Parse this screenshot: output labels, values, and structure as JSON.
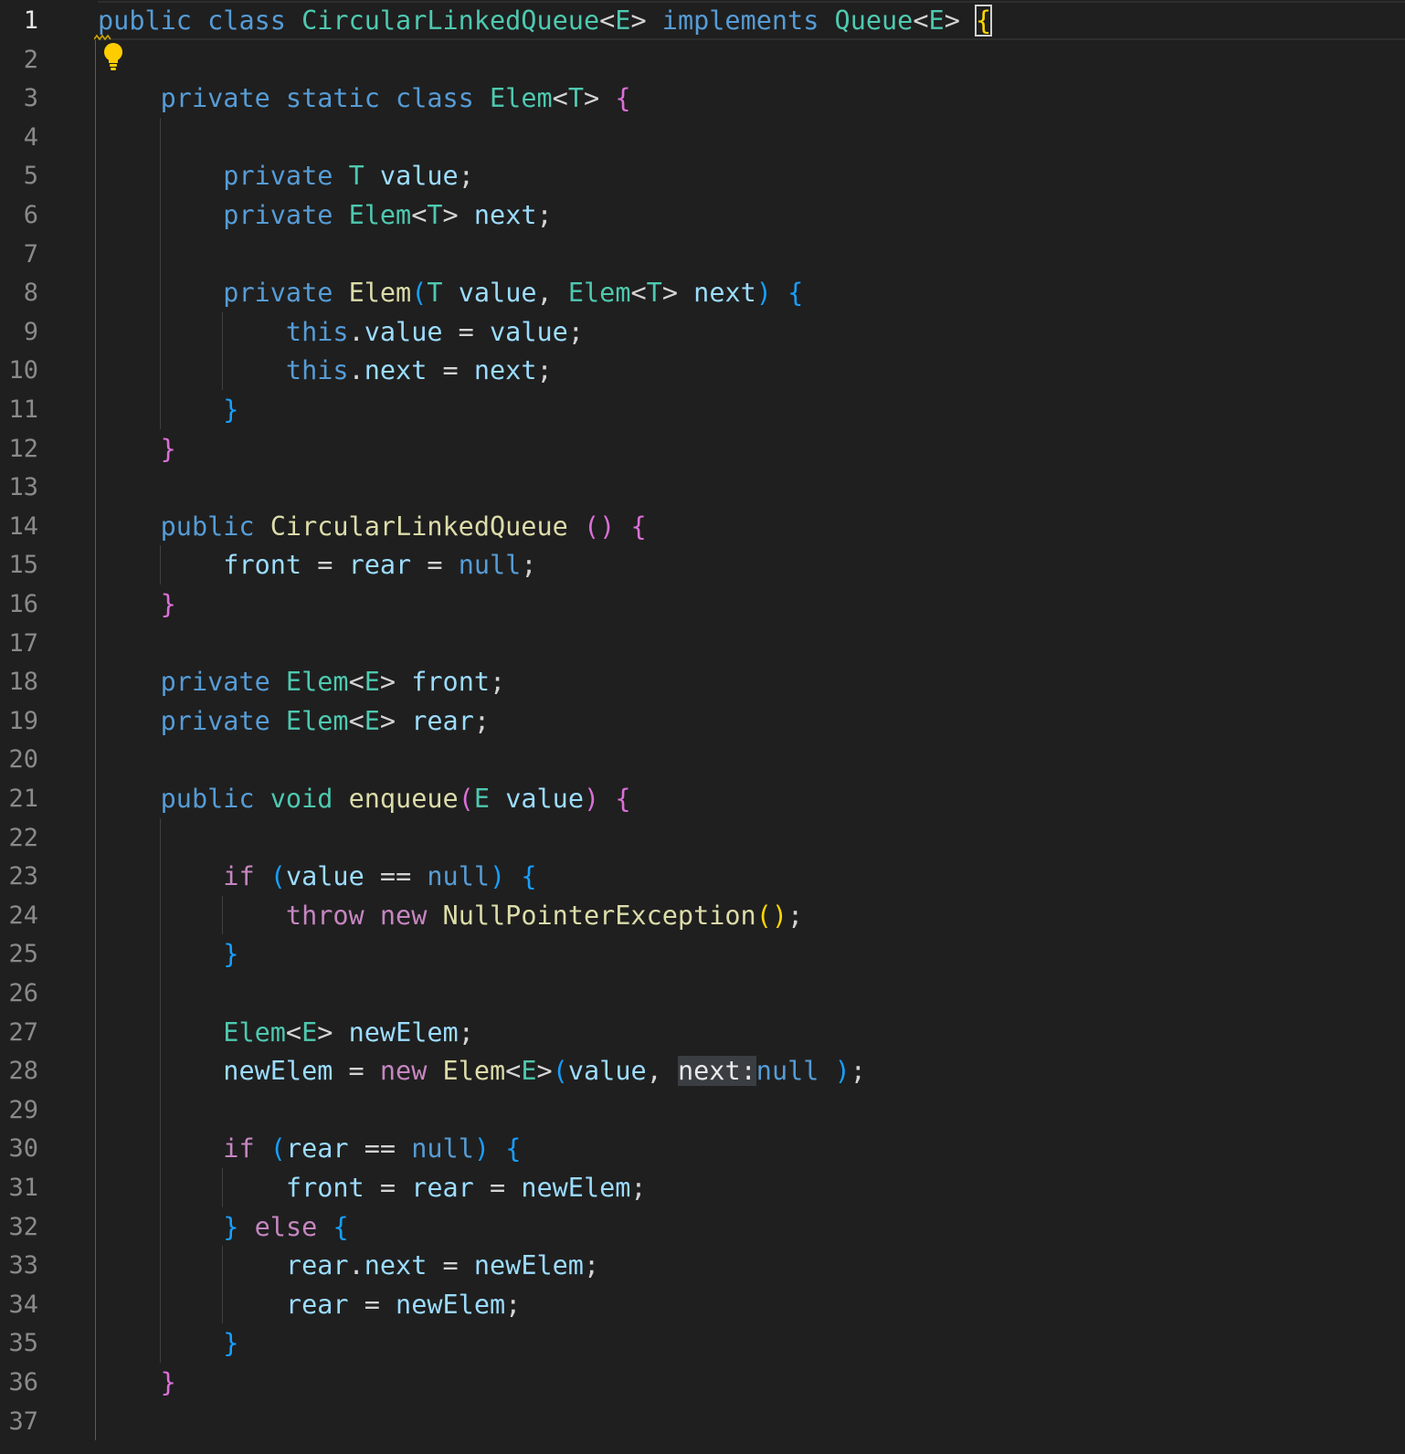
{
  "editor": {
    "language": "java",
    "current_line": 1,
    "line_numbers": [
      "1",
      "2",
      "3",
      "4",
      "5",
      "6",
      "7",
      "8",
      "9",
      "10",
      "11",
      "12",
      "13",
      "14",
      "15",
      "16",
      "17",
      "18",
      "19",
      "20",
      "21",
      "22",
      "23",
      "24",
      "25",
      "26",
      "27",
      "28",
      "29",
      "30",
      "31",
      "32",
      "33",
      "34",
      "35",
      "36",
      "37"
    ],
    "colors": {
      "background": "#1f1f1f",
      "keyword": "#569cd6",
      "control_keyword": "#c586c0",
      "type": "#4ec9b0",
      "function": "#dcdcaa",
      "variable": "#9cdcfe",
      "bracket_level_1": "#ffd700",
      "bracket_level_2": "#da70d6",
      "bracket_level_3": "#179fff",
      "inlay_hint_bg": "#3a3d41"
    },
    "lightbulb_icon": "lightbulb-icon",
    "lines": [
      [
        [
          "kw-blue",
          "public"
        ],
        [
          "punc",
          " "
        ],
        [
          "kw-blue",
          "class"
        ],
        [
          "punc",
          " "
        ],
        [
          "type",
          "CircularLinkedQueue"
        ],
        [
          "punc",
          "<"
        ],
        [
          "type",
          "E"
        ],
        [
          "punc",
          "> "
        ],
        [
          "kw-blue",
          "implements"
        ],
        [
          "punc",
          " "
        ],
        [
          "type",
          "Queue"
        ],
        [
          "punc",
          "<"
        ],
        [
          "type",
          "E"
        ],
        [
          "punc",
          "> "
        ],
        [
          "b1 cursor-box",
          "{"
        ]
      ],
      [],
      [
        [
          "punc",
          "    "
        ],
        [
          "kw-blue",
          "private"
        ],
        [
          "punc",
          " "
        ],
        [
          "kw-blue",
          "static"
        ],
        [
          "punc",
          " "
        ],
        [
          "kw-blue",
          "class"
        ],
        [
          "punc",
          " "
        ],
        [
          "type",
          "Elem"
        ],
        [
          "punc",
          "<"
        ],
        [
          "type",
          "T"
        ],
        [
          "punc",
          "> "
        ],
        [
          "b2",
          "{"
        ]
      ],
      [],
      [
        [
          "punc",
          "        "
        ],
        [
          "kw-blue",
          "private"
        ],
        [
          "punc",
          " "
        ],
        [
          "type",
          "T"
        ],
        [
          "punc",
          " "
        ],
        [
          "var",
          "value"
        ],
        [
          "punc",
          ";"
        ]
      ],
      [
        [
          "punc",
          "        "
        ],
        [
          "kw-blue",
          "private"
        ],
        [
          "punc",
          " "
        ],
        [
          "type",
          "Elem"
        ],
        [
          "punc",
          "<"
        ],
        [
          "type",
          "T"
        ],
        [
          "punc",
          "> "
        ],
        [
          "var",
          "next"
        ],
        [
          "punc",
          ";"
        ]
      ],
      [],
      [
        [
          "punc",
          "        "
        ],
        [
          "kw-blue",
          "private"
        ],
        [
          "punc",
          " "
        ],
        [
          "fn",
          "Elem"
        ],
        [
          "b3",
          "("
        ],
        [
          "type",
          "T"
        ],
        [
          "punc",
          " "
        ],
        [
          "var",
          "value"
        ],
        [
          "punc",
          ", "
        ],
        [
          "type",
          "Elem"
        ],
        [
          "punc",
          "<"
        ],
        [
          "type",
          "T"
        ],
        [
          "punc",
          "> "
        ],
        [
          "var",
          "next"
        ],
        [
          "b3",
          ")"
        ],
        [
          "punc",
          " "
        ],
        [
          "b3",
          "{"
        ]
      ],
      [
        [
          "punc",
          "            "
        ],
        [
          "kw-blue",
          "this"
        ],
        [
          "punc",
          "."
        ],
        [
          "var",
          "value"
        ],
        [
          "punc",
          " = "
        ],
        [
          "var",
          "value"
        ],
        [
          "punc",
          ";"
        ]
      ],
      [
        [
          "punc",
          "            "
        ],
        [
          "kw-blue",
          "this"
        ],
        [
          "punc",
          "."
        ],
        [
          "var",
          "next"
        ],
        [
          "punc",
          " = "
        ],
        [
          "var",
          "next"
        ],
        [
          "punc",
          ";"
        ]
      ],
      [
        [
          "punc",
          "        "
        ],
        [
          "b3",
          "}"
        ]
      ],
      [
        [
          "punc",
          "    "
        ],
        [
          "b2",
          "}"
        ]
      ],
      [],
      [
        [
          "punc",
          "    "
        ],
        [
          "kw-blue",
          "public"
        ],
        [
          "punc",
          " "
        ],
        [
          "fn",
          "CircularLinkedQueue"
        ],
        [
          "punc",
          " "
        ],
        [
          "b2",
          "()"
        ],
        [
          "punc",
          " "
        ],
        [
          "b2",
          "{"
        ]
      ],
      [
        [
          "punc",
          "        "
        ],
        [
          "var",
          "front"
        ],
        [
          "punc",
          " = "
        ],
        [
          "var",
          "rear"
        ],
        [
          "punc",
          " = "
        ],
        [
          "kw-blue",
          "null"
        ],
        [
          "punc",
          ";"
        ]
      ],
      [
        [
          "punc",
          "    "
        ],
        [
          "b2",
          "}"
        ]
      ],
      [],
      [
        [
          "punc",
          "    "
        ],
        [
          "kw-blue",
          "private"
        ],
        [
          "punc",
          " "
        ],
        [
          "type",
          "Elem"
        ],
        [
          "punc",
          "<"
        ],
        [
          "type",
          "E"
        ],
        [
          "punc",
          "> "
        ],
        [
          "var",
          "front"
        ],
        [
          "punc",
          ";"
        ]
      ],
      [
        [
          "punc",
          "    "
        ],
        [
          "kw-blue",
          "private"
        ],
        [
          "punc",
          " "
        ],
        [
          "type",
          "Elem"
        ],
        [
          "punc",
          "<"
        ],
        [
          "type",
          "E"
        ],
        [
          "punc",
          "> "
        ],
        [
          "var",
          "rear"
        ],
        [
          "punc",
          ";"
        ]
      ],
      [],
      [
        [
          "punc",
          "    "
        ],
        [
          "kw-blue",
          "public"
        ],
        [
          "punc",
          " "
        ],
        [
          "type",
          "void"
        ],
        [
          "punc",
          " "
        ],
        [
          "fn",
          "enqueue"
        ],
        [
          "b2",
          "("
        ],
        [
          "type",
          "E"
        ],
        [
          "punc",
          " "
        ],
        [
          "var",
          "value"
        ],
        [
          "b2",
          ")"
        ],
        [
          "punc",
          " "
        ],
        [
          "b2",
          "{"
        ]
      ],
      [],
      [
        [
          "punc",
          "        "
        ],
        [
          "kw-pink",
          "if"
        ],
        [
          "punc",
          " "
        ],
        [
          "b3",
          "("
        ],
        [
          "var",
          "value"
        ],
        [
          "punc",
          " == "
        ],
        [
          "kw-blue",
          "null"
        ],
        [
          "b3",
          ")"
        ],
        [
          "punc",
          " "
        ],
        [
          "b3",
          "{"
        ]
      ],
      [
        [
          "punc",
          "            "
        ],
        [
          "kw-pink",
          "throw"
        ],
        [
          "punc",
          " "
        ],
        [
          "kw-pink",
          "new"
        ],
        [
          "punc",
          " "
        ],
        [
          "fn",
          "NullPointerException"
        ],
        [
          "b1",
          "()"
        ],
        [
          "punc",
          ";"
        ]
      ],
      [
        [
          "punc",
          "        "
        ],
        [
          "b3",
          "}"
        ]
      ],
      [],
      [
        [
          "punc",
          "        "
        ],
        [
          "type",
          "Elem"
        ],
        [
          "punc",
          "<"
        ],
        [
          "type",
          "E"
        ],
        [
          "punc",
          "> "
        ],
        [
          "var",
          "newElem"
        ],
        [
          "punc",
          ";"
        ]
      ],
      [
        [
          "punc",
          "        "
        ],
        [
          "var",
          "newElem"
        ],
        [
          "punc",
          " = "
        ],
        [
          "kw-pink",
          "new"
        ],
        [
          "punc",
          " "
        ],
        [
          "fn",
          "Elem"
        ],
        [
          "punc",
          "<"
        ],
        [
          "type",
          "E"
        ],
        [
          "punc",
          ">"
        ],
        [
          "b3",
          "("
        ],
        [
          "var",
          "value"
        ],
        [
          "punc",
          ", "
        ],
        [
          "hint",
          "next:"
        ],
        [
          "kw-blue",
          "null"
        ],
        [
          "punc",
          " "
        ],
        [
          "b3",
          ")"
        ],
        [
          "punc",
          ";"
        ]
      ],
      [],
      [
        [
          "punc",
          "        "
        ],
        [
          "kw-pink",
          "if"
        ],
        [
          "punc",
          " "
        ],
        [
          "b3",
          "("
        ],
        [
          "var",
          "rear"
        ],
        [
          "punc",
          " == "
        ],
        [
          "kw-blue",
          "null"
        ],
        [
          "b3",
          ")"
        ],
        [
          "punc",
          " "
        ],
        [
          "b3",
          "{"
        ]
      ],
      [
        [
          "punc",
          "            "
        ],
        [
          "var",
          "front"
        ],
        [
          "punc",
          " = "
        ],
        [
          "var",
          "rear"
        ],
        [
          "punc",
          " = "
        ],
        [
          "var",
          "newElem"
        ],
        [
          "punc",
          ";"
        ]
      ],
      [
        [
          "punc",
          "        "
        ],
        [
          "b3",
          "}"
        ],
        [
          "punc",
          " "
        ],
        [
          "kw-pink",
          "else"
        ],
        [
          "punc",
          " "
        ],
        [
          "b3",
          "{"
        ]
      ],
      [
        [
          "punc",
          "            "
        ],
        [
          "var",
          "rear"
        ],
        [
          "punc",
          "."
        ],
        [
          "var",
          "next"
        ],
        [
          "punc",
          " = "
        ],
        [
          "var",
          "newElem"
        ],
        [
          "punc",
          ";"
        ]
      ],
      [
        [
          "punc",
          "            "
        ],
        [
          "var",
          "rear"
        ],
        [
          "punc",
          " = "
        ],
        [
          "var",
          "newElem"
        ],
        [
          "punc",
          ";"
        ]
      ],
      [
        [
          "punc",
          "        "
        ],
        [
          "b3",
          "}"
        ]
      ],
      [
        [
          "punc",
          "    "
        ],
        [
          "b2",
          "}"
        ]
      ],
      []
    ]
  }
}
